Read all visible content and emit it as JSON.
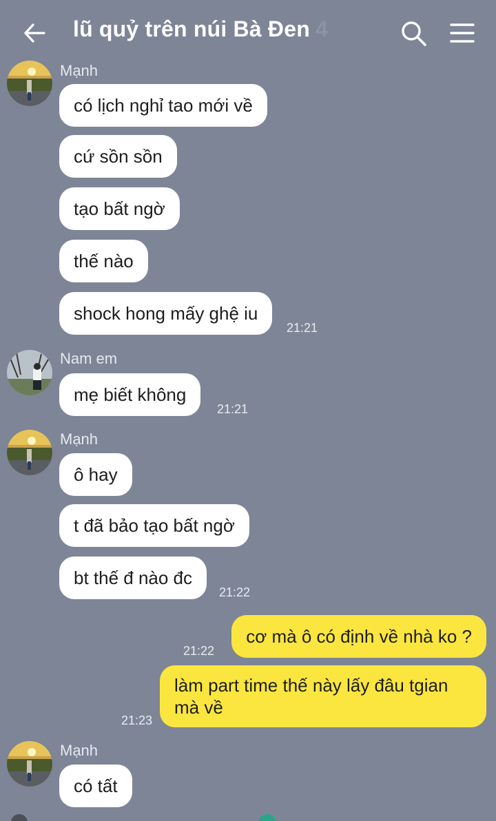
{
  "header": {
    "title": "lũ quỷ trên núi Bà Đen",
    "member_count": "4"
  },
  "messages": [
    {
      "sender": "Mạnh",
      "bubbles": [
        "có lịch nghỉ tao mới về",
        "cứ sồn sồn",
        "tạo bất ngờ",
        "thế nào",
        "shock hong mấy ghệ iu"
      ],
      "time": "21:21"
    },
    {
      "sender": "Nam em",
      "bubbles": [
        "mẹ biết không"
      ],
      "time": "21:21"
    },
    {
      "sender": "Mạnh",
      "bubbles": [
        "ô hay",
        "t đã bảo tạo bất ngờ",
        "bt thế đ nào đc"
      ],
      "time": "21:22"
    },
    {
      "sender": "me",
      "bubbles": [
        "cơ mà ô có định về nhà ko ?"
      ],
      "time": "21:22"
    },
    {
      "sender": "me",
      "bubbles": [
        "làm part time thế này lấy đâu tgian mà về"
      ],
      "time": "21:23"
    },
    {
      "sender": "Mạnh",
      "bubbles": [
        "có tất"
      ],
      "time": ""
    }
  ],
  "colors": {
    "background": "#7d8597",
    "incoming_bubble": "#ffffff",
    "outgoing_bubble": "#fbe63f"
  }
}
